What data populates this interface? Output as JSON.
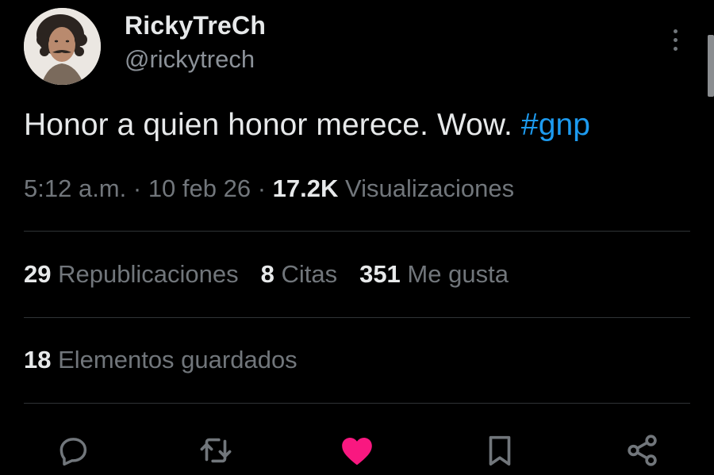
{
  "author": {
    "display_name": "RickyTreCh",
    "handle": "@rickytrech"
  },
  "tweet": {
    "text": "Honor a quien honor merece. Wow. ",
    "hashtag": "#gnp"
  },
  "meta": {
    "time": "5:12 a.m.",
    "separator": " · ",
    "date": "10 feb 26",
    "views_count": "17.2K",
    "views_label": " Visualizaciones"
  },
  "stats": {
    "reposts_count": "29",
    "reposts_label": " Republicaciones",
    "quotes_count": "8",
    "quotes_label": " Citas",
    "likes_count": "351",
    "likes_label": " Me gusta",
    "bookmarks_count": "18",
    "bookmarks_label": " Elementos guardados"
  },
  "colors": {
    "background": "#000000",
    "text": "#e7e9ea",
    "secondary": "#71767b",
    "hashtag": "#1d9bf0",
    "like_active": "#f91880",
    "divider": "#2f3336"
  },
  "actions": {
    "reply_icon": "reply-icon",
    "repost_icon": "repost-icon",
    "like_icon": "heart-icon",
    "bookmark_icon": "bookmark-icon",
    "share_icon": "share-icon",
    "like_active": true
  }
}
